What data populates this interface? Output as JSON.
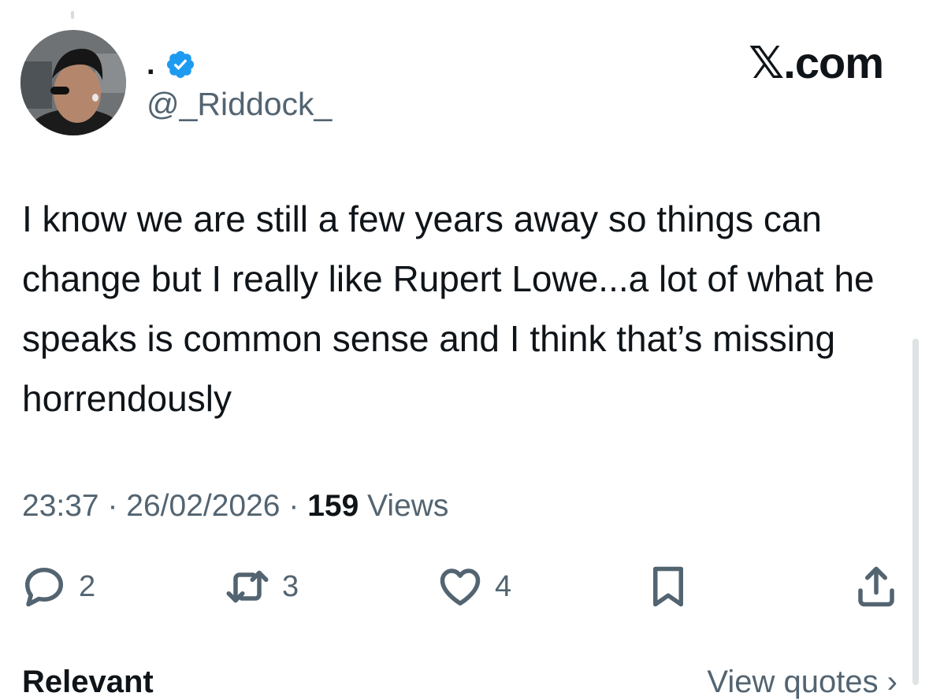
{
  "tweet": {
    "author": {
      "display_name": ".",
      "handle": "@_Riddock_",
      "verified": true
    },
    "site": "𝕏.com",
    "text": "I know we are still a few years away so things can change but I really like Rupert Lowe...a lot of what he speaks is common sense and I think that’s missing horrendously",
    "time": "23:37",
    "date": "26/02/2026",
    "views_count": "159",
    "views_label": "Views",
    "separator": "·",
    "actions": {
      "replies": "2",
      "reposts": "3",
      "likes": "4"
    }
  },
  "bottom": {
    "left_label": "Relevant",
    "right_label": "View quotes ›"
  },
  "colors": {
    "text": "#0f1419",
    "secondary": "#536471",
    "verified": "#1d9bf0"
  },
  "icons": [
    "verified-badge-icon",
    "reply-icon",
    "repost-icon",
    "like-icon",
    "bookmark-icon",
    "share-icon"
  ]
}
